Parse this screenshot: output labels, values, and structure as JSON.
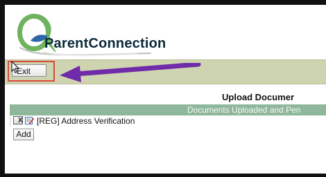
{
  "header": {
    "brand_name": "ParentConnection",
    "logo_icon": "q-leaf-logo-icon"
  },
  "toolbar": {
    "exit_label": "Exit",
    "cursor_icon": "mouse-pointer-icon",
    "highlight_color": "#d94b3c",
    "arrow_icon": "purple-arrow-icon",
    "arrow_color": "#6f2ba8"
  },
  "main": {
    "title": "Upload Documer",
    "section_header": "Documents Uploaded and Pen",
    "documents": [
      {
        "delete_label": "X",
        "edit_icon": "edit-icon",
        "name": "[REG] Address Verification"
      }
    ],
    "add_label": "Add"
  },
  "colors": {
    "toolbar_bg": "#cfd4b0",
    "section_bg": "#8fb79b",
    "outer_bg": "#111111"
  }
}
